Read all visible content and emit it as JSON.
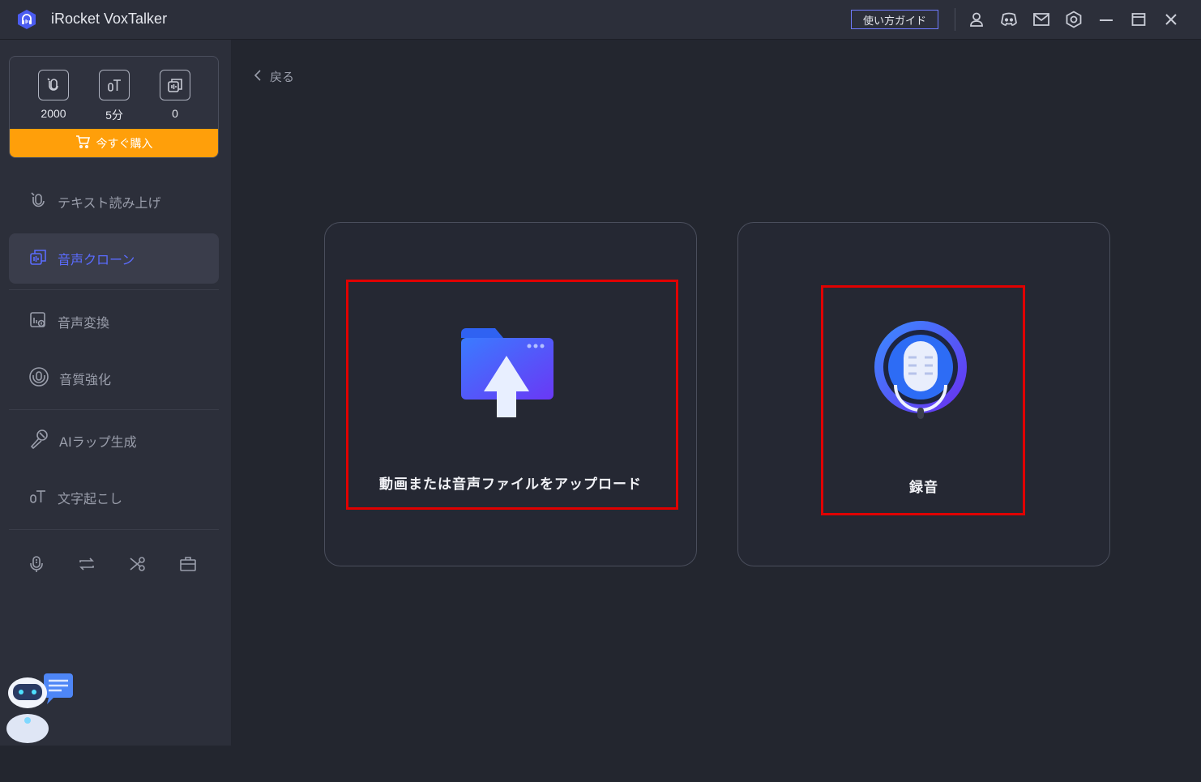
{
  "app": {
    "title": "iRocket VoxTalker"
  },
  "titlebar": {
    "guide_label": "使い方ガイド",
    "icons": [
      "user-icon",
      "discord-icon",
      "mail-icon",
      "settings-icon",
      "minimize-icon",
      "maximize-icon",
      "close-icon"
    ]
  },
  "credits": {
    "items": [
      {
        "icon": "tts-credit-icon",
        "value": "2000"
      },
      {
        "icon": "transcribe-credit-icon",
        "value": "5分"
      },
      {
        "icon": "clone-credit-icon",
        "value": "0"
      }
    ],
    "buy_label": "今すぐ購入"
  },
  "nav": {
    "items": [
      {
        "label": "テキスト読み上げ",
        "icon": "tts-icon"
      },
      {
        "label": "音声クローン",
        "icon": "voice-clone-icon",
        "active": true
      },
      {
        "label": "音声変換",
        "icon": "voice-convert-icon"
      },
      {
        "label": "音質強化",
        "icon": "audio-enhance-icon"
      },
      {
        "label": "AIラップ生成",
        "icon": "rap-mic-icon"
      },
      {
        "label": "文字起こし",
        "icon": "transcribe-icon"
      }
    ]
  },
  "tools": [
    "mic-tool-icon",
    "repeat-tool-icon",
    "scissors-tool-icon",
    "toolbox-icon"
  ],
  "main": {
    "back_label": "戻る",
    "cards": [
      {
        "label": "動画または音声ファイルをアップロード",
        "icon": "upload-folder-icon"
      },
      {
        "label": "録音",
        "icon": "microphone-record-icon"
      }
    ]
  },
  "colors": {
    "accent": "#5b6cff",
    "buy": "#ff9f0a",
    "highlight": "#e00000",
    "sidebar_bg": "#2c2f3a",
    "main_bg": "#23262f"
  }
}
